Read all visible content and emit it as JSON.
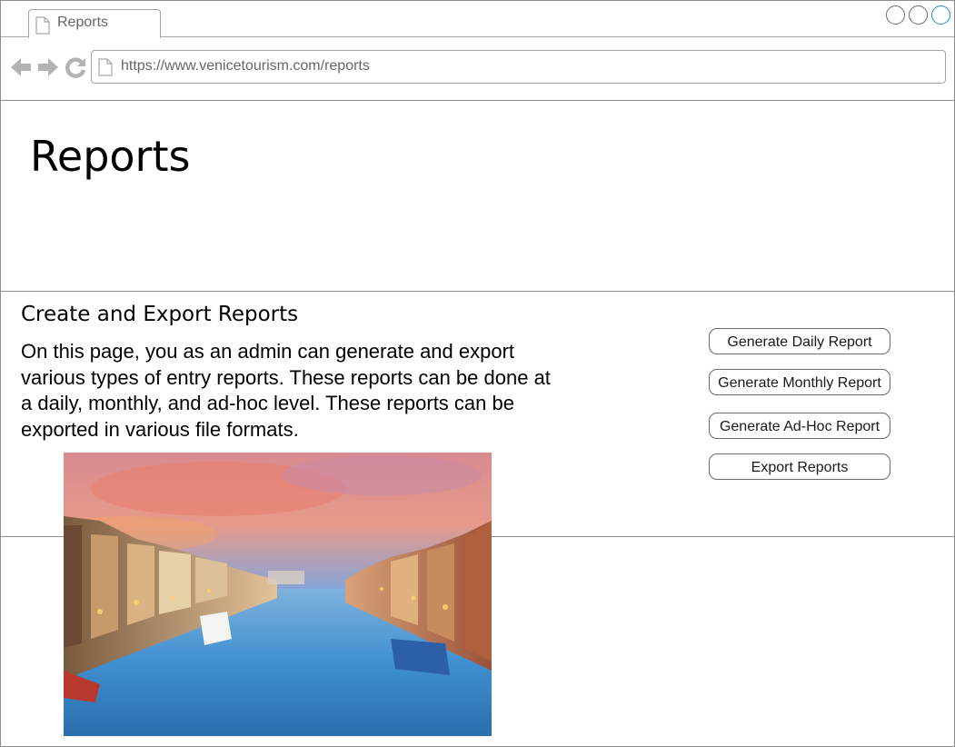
{
  "browser": {
    "tab_title": "Reports",
    "url": "https://www.venicetourism.com/reports",
    "window_button_colors": [
      "#6b6b6b",
      "#6b6b6b",
      "#1a8fd6"
    ]
  },
  "page": {
    "title": "Reports"
  },
  "section": {
    "heading": "Create and Export Reports",
    "description": "On this page, you as an admin can generate and export various types of entry reports. These reports can be done at a daily, monthly, and ad-hoc level. These reports can be exported in various file formats.",
    "image_icon": "venice-grand-canal-photo"
  },
  "actions": {
    "daily": "Generate Daily Report",
    "monthly": "Generate Monthly Report",
    "adhoc": "Generate Ad-Hoc Report",
    "export": "Export Reports"
  },
  "icons": {
    "tab": "document-icon",
    "back": "back-arrow-icon",
    "forward": "forward-arrow-icon",
    "reload": "reload-icon",
    "address": "document-icon"
  }
}
